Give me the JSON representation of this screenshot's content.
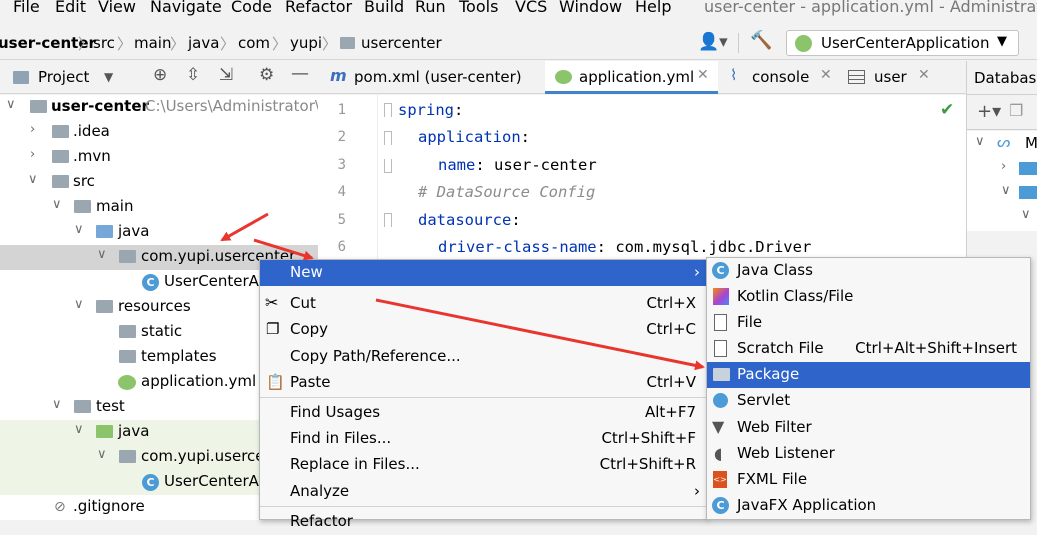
{
  "menubar": {
    "items": [
      "File",
      "Edit",
      "View",
      "Navigate",
      "Code",
      "Refactor",
      "Build",
      "Run",
      "Tools",
      "VCS",
      "Window",
      "Help"
    ],
    "window_title": "user-center - application.yml - Administrator"
  },
  "breadcrumb": {
    "items": [
      "user-center",
      "src",
      "main",
      "java",
      "com",
      "yupi",
      "usercenter"
    ]
  },
  "run_config": {
    "label": "UserCenterApplication"
  },
  "project_panel": {
    "title": "Project"
  },
  "editor_tabs": [
    {
      "label": "pom.xml (user-center)",
      "icon": "maven-icon"
    },
    {
      "label": "application.yml",
      "icon": "yaml-icon",
      "active": true
    },
    {
      "label": "console",
      "icon": "console-icon"
    },
    {
      "label": "user",
      "icon": "table-icon"
    }
  ],
  "database_panel": {
    "title": "Database",
    "items": [
      "M"
    ]
  },
  "tree": [
    {
      "label": "user-center",
      "path": "C:\\Users\\Administrator\\"
    },
    {
      "label": ".idea"
    },
    {
      "label": ".mvn"
    },
    {
      "label": "src"
    },
    {
      "label": "main"
    },
    {
      "label": "java"
    },
    {
      "label": "com.yupi.usercenter"
    },
    {
      "label": "UserCenterAp"
    },
    {
      "label": "resources"
    },
    {
      "label": "static"
    },
    {
      "label": "templates"
    },
    {
      "label": "application.yml"
    },
    {
      "label": "test"
    },
    {
      "label": "java"
    },
    {
      "label": "com.yupi.userce"
    },
    {
      "label": "UserCenterAp"
    },
    {
      "label": ".gitignore"
    }
  ],
  "editor": {
    "lines": [
      {
        "n": "1",
        "key": "spring",
        "val": ""
      },
      {
        "n": "2",
        "key": "application",
        "val": ""
      },
      {
        "n": "3",
        "key": "name",
        "val": "user-center"
      },
      {
        "n": "4",
        "comment": "# DataSource Config"
      },
      {
        "n": "5",
        "key": "datasource",
        "val": ""
      },
      {
        "n": "6",
        "key": "driver-class-name",
        "val": "com.mysql.jdbc.Driver"
      }
    ]
  },
  "context_menu": {
    "items": [
      {
        "label": "New",
        "shortcut": ""
      },
      {
        "label": "Cut",
        "shortcut": "Ctrl+X"
      },
      {
        "label": "Copy",
        "shortcut": "Ctrl+C"
      },
      {
        "label": "Copy Path/Reference...",
        "shortcut": ""
      },
      {
        "label": "Paste",
        "shortcut": "Ctrl+V"
      },
      {
        "label": "Find Usages",
        "shortcut": "Alt+F7"
      },
      {
        "label": "Find in Files...",
        "shortcut": "Ctrl+Shift+F"
      },
      {
        "label": "Replace in Files...",
        "shortcut": "Ctrl+Shift+R"
      },
      {
        "label": "Analyze",
        "shortcut": ""
      },
      {
        "label": "Refactor",
        "shortcut": ""
      }
    ]
  },
  "new_submenu": {
    "items": [
      {
        "label": "Java Class",
        "shortcut": ""
      },
      {
        "label": "Kotlin Class/File",
        "shortcut": ""
      },
      {
        "label": "File",
        "shortcut": ""
      },
      {
        "label": "Scratch File",
        "shortcut": "Ctrl+Alt+Shift+Insert"
      },
      {
        "label": "Package",
        "shortcut": ""
      },
      {
        "label": "Servlet",
        "shortcut": ""
      },
      {
        "label": "Web Filter",
        "shortcut": ""
      },
      {
        "label": "Web Listener",
        "shortcut": ""
      },
      {
        "label": "FXML File",
        "shortcut": ""
      },
      {
        "label": "JavaFX Application",
        "shortcut": ""
      }
    ]
  },
  "colors": {
    "selection": "#2f65ca",
    "annotation_arrow": "#e8362f"
  }
}
